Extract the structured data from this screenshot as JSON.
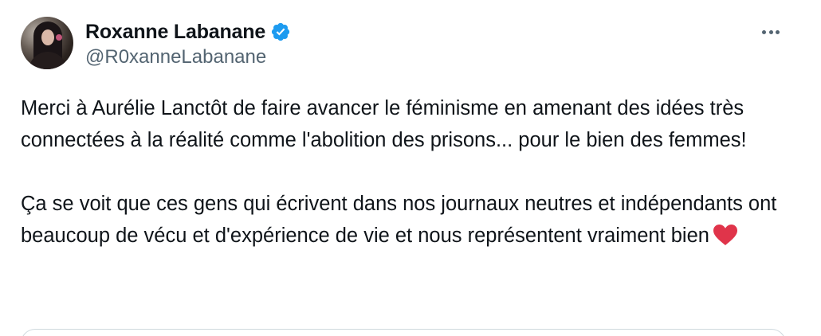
{
  "tweet": {
    "author": {
      "display_name": "Roxanne Labanane",
      "handle": "@R0xanneLabanane",
      "verified": true,
      "verified_icon": "verified-badge-icon",
      "verified_color": "#1d9bf0"
    },
    "more_icon": "more-horizontal-icon",
    "text": {
      "paragraph_1": "Merci à Aurélie Lanctôt de faire avancer le féminisme en amenant des idées très connectées à la réalité comme l'abolition des prisons... pour le bien des femmes!",
      "paragraph_2": "Ça se voit que ces gens qui écrivent dans nos journaux neutres et indépendants ont beaucoup de vécu et d'expérience de vie et nous représentent vraiment bien",
      "emoji": "red-heart-icon"
    },
    "colors": {
      "text_primary": "#0f1419",
      "text_secondary": "#536471",
      "heart": "#e0344a",
      "border": "#cfd9de"
    }
  }
}
